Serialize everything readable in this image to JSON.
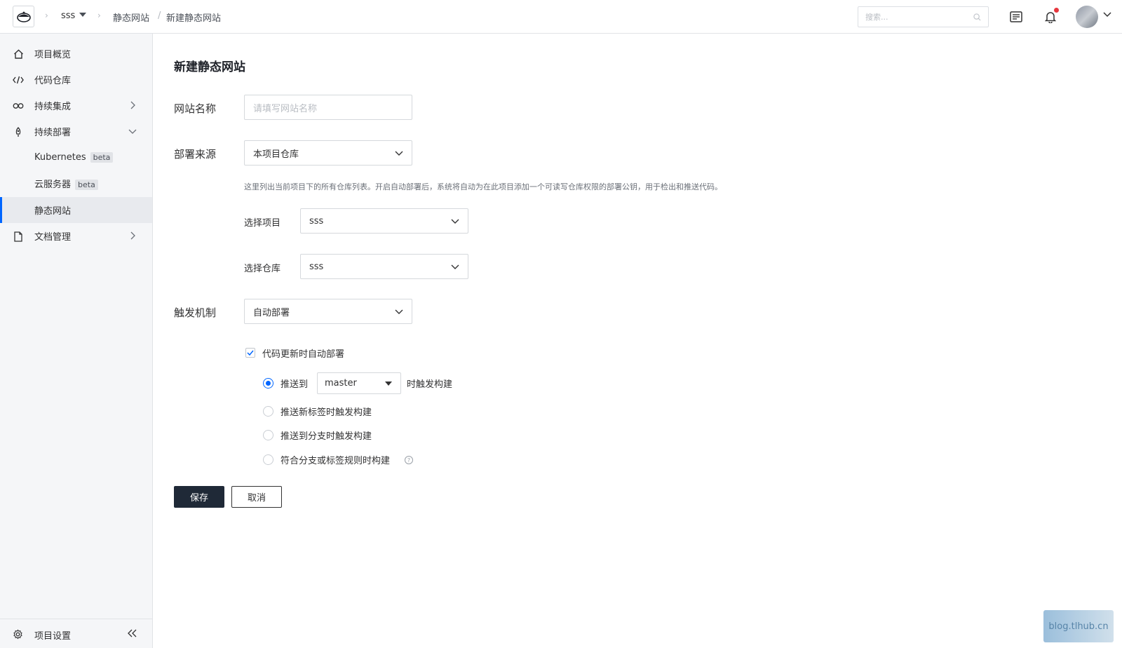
{
  "header": {
    "project": "sss",
    "breadcrumb": [
      "静态网站",
      "新建静态网站"
    ],
    "search_placeholder": "搜索..."
  },
  "sidebar": {
    "items": [
      {
        "label": "项目概览",
        "icon": "home-icon"
      },
      {
        "label": "代码仓库",
        "icon": "code-icon"
      },
      {
        "label": "持续集成",
        "icon": "infinity-icon"
      },
      {
        "label": "持续部署",
        "icon": "rocket-icon"
      },
      {
        "label": "Kubernetes",
        "badge": "beta"
      },
      {
        "label": "云服务器",
        "badge": "beta"
      },
      {
        "label": "静态网站",
        "active": true
      },
      {
        "label": "文档管理",
        "icon": "document-icon"
      }
    ],
    "footer": {
      "label": "项目设置",
      "icon": "gear-icon"
    }
  },
  "form": {
    "title": "新建静态网站",
    "site_name": {
      "label": "网站名称",
      "placeholder": "请填写网站名称",
      "value": ""
    },
    "source": {
      "label": "部署来源",
      "value": "本项目仓库",
      "hint": "这里列出当前项目下的所有仓库列表。开启自动部署后，系统将自动为在此项目添加一个可读写仓库权限的部署公钥，用于检出和推送代码。"
    },
    "project": {
      "label": "选择项目",
      "value": "sss"
    },
    "repo": {
      "label": "选择仓库",
      "value": "sss"
    },
    "trigger": {
      "label": "触发机制",
      "value": "自动部署"
    },
    "auto_deploy_checkbox": {
      "label": "代码更新时自动部署",
      "checked": true
    },
    "options": {
      "push_to": {
        "label_before": "推送到",
        "branch": "master",
        "label_after": "时触发构建",
        "selected": true
      },
      "push_tag": {
        "label": "推送新标签时触发构建",
        "selected": false
      },
      "push_branch": {
        "label": "推送到分支时触发构建",
        "selected": false
      },
      "match_rule": {
        "label": "符合分支或标签规则时构建",
        "selected": false
      }
    },
    "save": "保存",
    "cancel": "取消"
  },
  "watermark": "blog.tlhub.cn"
}
